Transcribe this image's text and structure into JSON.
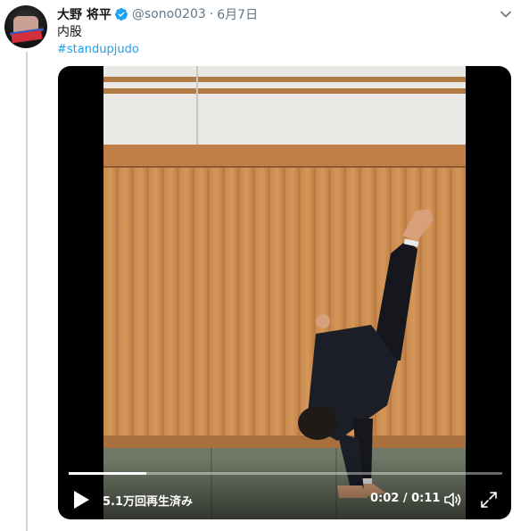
{
  "tweet": {
    "display_name": "大野 将平",
    "handle": "@sono0203",
    "separator": "·",
    "date": "6月7日",
    "text": "内股",
    "hashtag": "#standupjudo"
  },
  "video": {
    "views": "5.1万回再生済み",
    "time": "0:02 / 0:11",
    "progress": 0.18
  },
  "colors": {
    "link": "#1da1f2",
    "verified": "#1da1f2",
    "secondary_text": "#657786"
  },
  "icons": [
    "verified-badge-icon",
    "caret-down-icon",
    "play-icon",
    "volume-icon",
    "fullscreen-icon"
  ]
}
